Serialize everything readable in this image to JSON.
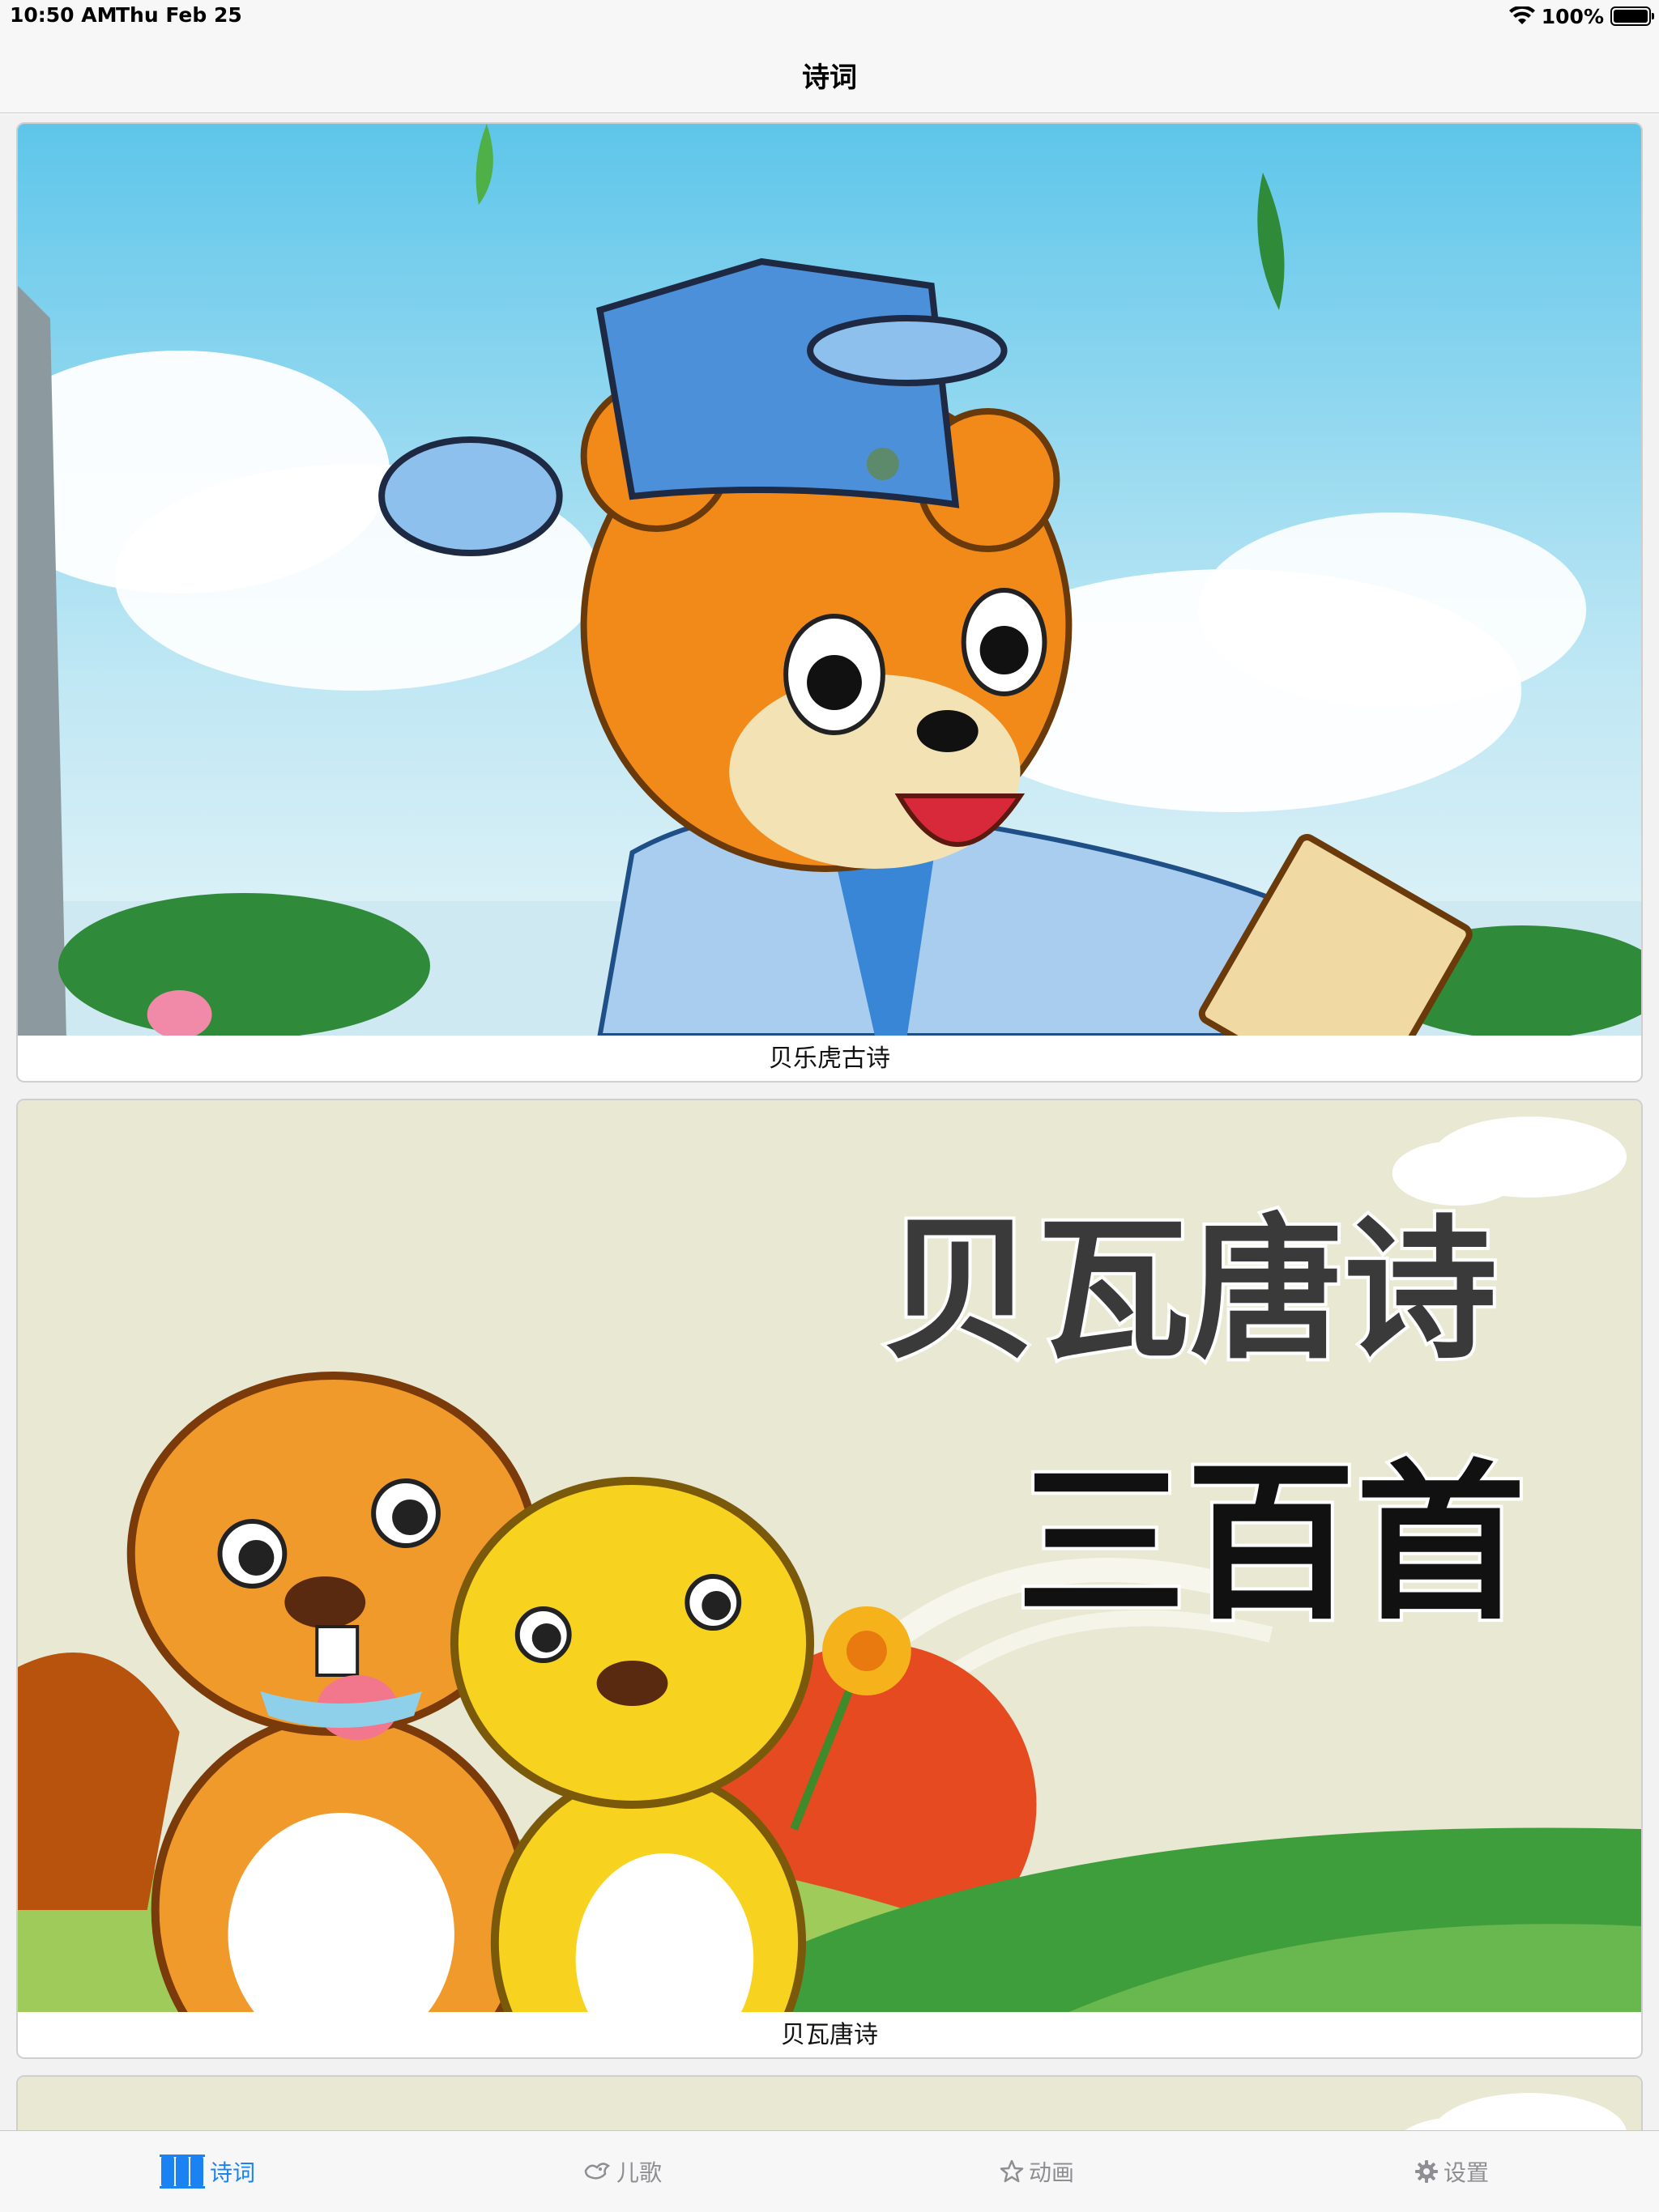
{
  "status_bar": {
    "time": "10:50 AM",
    "date": "Thu Feb 25",
    "battery": "100%",
    "wifi_icon": "wifi-icon",
    "battery_icon": "battery-icon"
  },
  "nav": {
    "title": "诗词"
  },
  "cards": [
    {
      "caption": "贝乐虎古诗",
      "image": "tiger-scholar-illustration"
    },
    {
      "caption": "贝瓦唐诗",
      "image": "beavers-illustration",
      "image_text_line1": "贝瓦唐诗",
      "image_text_line2": "三百首"
    },
    {
      "caption": "",
      "image": "partial-illustration"
    }
  ],
  "tab_bar": {
    "tabs": [
      {
        "label": "诗词",
        "icon": "book-icon",
        "active": true
      },
      {
        "label": "儿歌",
        "icon": "bird-icon",
        "active": false
      },
      {
        "label": "动画",
        "icon": "star-icon",
        "active": false
      },
      {
        "label": "设置",
        "icon": "gear-icon",
        "active": false
      }
    ]
  },
  "colors": {
    "accent": "#1a82f2",
    "inactive": "#8e8e93",
    "bar_bg": "#f7f7f7"
  }
}
